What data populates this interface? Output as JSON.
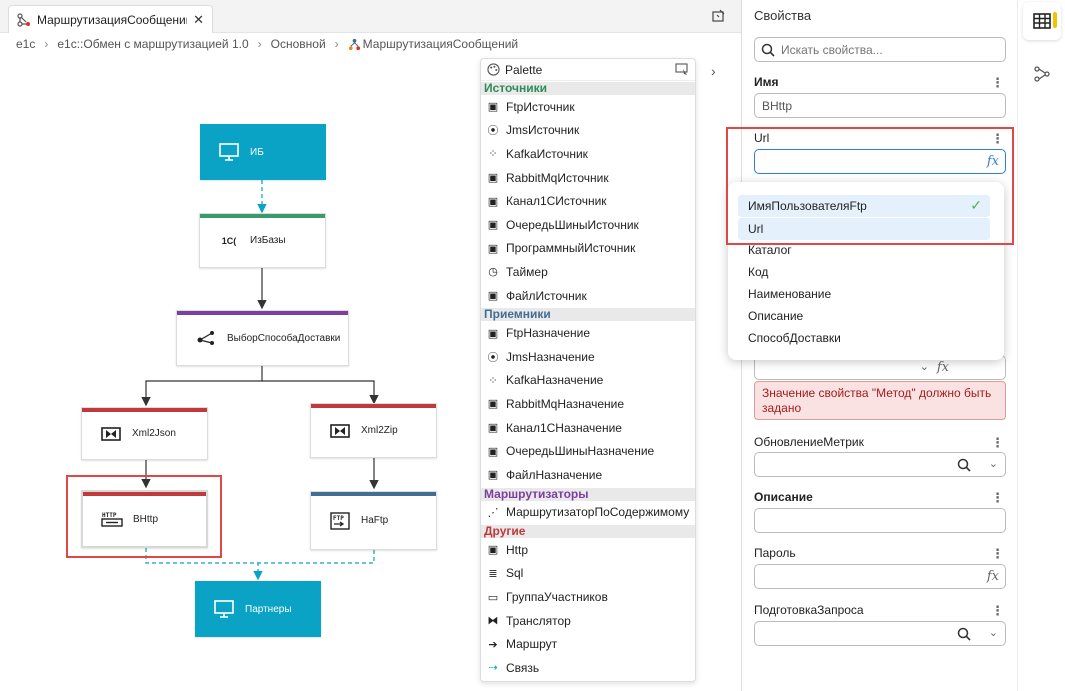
{
  "tab": {
    "title": "МаршрутизацияСообщений",
    "close": "✕"
  },
  "breadcrumb": [
    "e1c",
    "e1c::Обмен с маршрутизацией 1.0",
    "Основной",
    "МаршрутизацияСообщений"
  ],
  "diagram": {
    "nodes": {
      "ib": "ИБ",
      "izbazy": "ИзБазы",
      "vybor": "ВыборСпособаДоставки",
      "xml2json": "Xml2Json",
      "xml2zip": "Xml2Zip",
      "vhttp": "ВHttp",
      "naftp": "НаFtp",
      "partnery": "Партнеры"
    },
    "colors": {
      "teal": "#0aa2c5",
      "green": "#3a9a6a",
      "purple": "#7b3fa0",
      "red": "#c0393b",
      "blue": "#3f6e96",
      "selection": "#e04848"
    }
  },
  "palette": {
    "title": "Palette",
    "categories": [
      {
        "name": "Источники",
        "color": "#2e8b57",
        "items": [
          "FtpИсточник",
          "JmsИсточник",
          "KafkaИсточник",
          "RabbitMqИсточник",
          "Канал1СИсточник",
          "ОчередьШиныИсточник",
          "ПрограммныйИсточник",
          "Таймер",
          "ФайлИсточник"
        ]
      },
      {
        "name": "Приемники",
        "color": "#3f6e96",
        "items": [
          "FtpНазначение",
          "JmsНазначение",
          "KafkaНазначение",
          "RabbitMqНазначение",
          "Канал1СНазначение",
          "ОчередьШиныНазначение",
          "ФайлНазначение"
        ]
      },
      {
        "name": "Маршрутизаторы",
        "color": "#7b3fa0",
        "items": [
          "МаршрутизаторПоСодержимому"
        ]
      },
      {
        "name": "Другие",
        "color": "#c0393b",
        "items": [
          "Http",
          "Sql",
          "ГруппаУчастников",
          "Транслятор",
          "Маршрут",
          "Связь"
        ]
      }
    ]
  },
  "properties": {
    "title": "Свойства",
    "search_placeholder": "Искать свойства...",
    "name_label": "Имя",
    "name_value": "ВHttp",
    "url_label": "Url",
    "url_value": "",
    "fx": "fx",
    "url_options": [
      "ИмяПользователяFtp",
      "Url",
      "Каталог",
      "Код",
      "Наименование",
      "Описание",
      "СпособДоставки"
    ],
    "error_text": "Значение свойства \"Метод\" должно быть задано",
    "metrics_label": "ОбновлениеМетрик",
    "description_label": "Описание",
    "password_label": "Пароль",
    "request_prep_label": "ПодготовкаЗапроса",
    "accent_color": "#f4c400"
  }
}
